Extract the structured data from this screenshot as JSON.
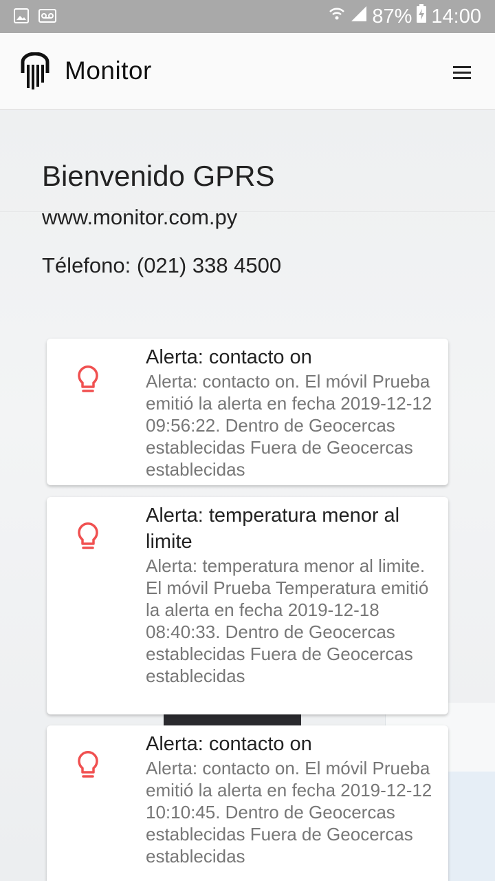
{
  "status_bar": {
    "battery_percent": "87%",
    "time": "14:00",
    "icons": [
      "image-icon",
      "voicemail-icon",
      "wifi-icon",
      "signal-icon",
      "battery-charging-icon"
    ]
  },
  "app_bar": {
    "title": "Monitor",
    "logo": "monitor-logo-icon",
    "menu_icon": "hamburger-menu-icon"
  },
  "header": {
    "welcome": "Bienvenido GPRS",
    "website": "www.monitor.com.py",
    "phone": "Télefono: (021) 338 4500"
  },
  "alerts": [
    {
      "icon": "lightbulb-icon",
      "title": "Alerta: contacto on",
      "body": "Alerta: contacto on. El móvil Prueba emitió la alerta en fecha 2019-12-12 09:56:22. Dentro de Geocercas establecidas Fuera de Geocercas establecidas"
    },
    {
      "icon": "lightbulb-icon",
      "title": "Alerta: temperatura menor al limite",
      "body": "Alerta: temperatura menor al limite. El móvil Prueba Temperatura emitió la alerta en fecha 2019-12-18 08:40:33. Dentro de Geocercas establecidas Fuera de Geocercas establecidas"
    },
    {
      "icon": "lightbulb-icon",
      "title": "Alerta: contacto on",
      "body": "Alerta: contacto on. El móvil Prueba emitió la alerta en fecha 2019-12-12 10:10:45. Dentro de Geocercas establecidas Fuera de Geocercas establecidas"
    }
  ],
  "colors": {
    "status_bar": "#a9a9a9",
    "app_bar": "#fafafa",
    "bulb_icon": "#f05050",
    "alert_body_text": "#777777"
  }
}
